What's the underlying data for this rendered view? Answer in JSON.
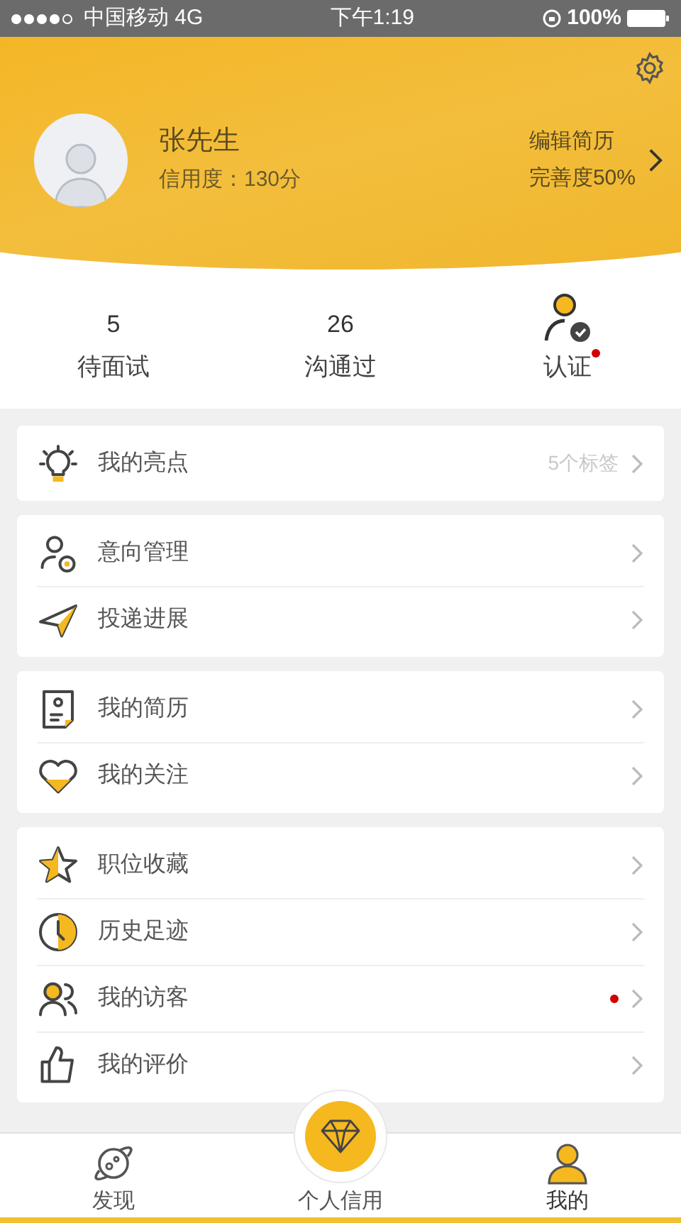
{
  "status_bar": {
    "carrier": "中国移动 4G",
    "time": "下午1:19",
    "battery": "100%"
  },
  "profile": {
    "name": "张先生",
    "credit": "信用度：130分",
    "edit": "编辑简历",
    "completeness": "完善度50%"
  },
  "stats": [
    {
      "kind": "count",
      "value": "5",
      "label": "待面试",
      "dot": false
    },
    {
      "kind": "count",
      "value": "26",
      "label": "沟通过",
      "dot": false
    },
    {
      "kind": "icon",
      "label": "认证",
      "dot": true
    }
  ],
  "groups": [
    [
      {
        "label": "我的亮点",
        "detail": "5个标签",
        "dot": false
      }
    ],
    [
      {
        "label": "意向管理",
        "dot": false
      },
      {
        "label": "投递进展",
        "dot": false
      }
    ],
    [
      {
        "label": "我的简历",
        "dot": false
      },
      {
        "label": "我的关注",
        "dot": false
      }
    ],
    [
      {
        "label": "职位收藏",
        "dot": false
      },
      {
        "label": "历史足迹",
        "dot": false
      },
      {
        "label": "我的访客",
        "dot": true
      },
      {
        "label": "我的评价",
        "dot": false
      }
    ]
  ],
  "tab_bar": [
    {
      "kind": "plain",
      "label": "发现",
      "selected": false
    },
    {
      "kind": "center",
      "label": "个人信用",
      "selected": false
    },
    {
      "kind": "plain",
      "label": "我的",
      "selected": true
    }
  ]
}
